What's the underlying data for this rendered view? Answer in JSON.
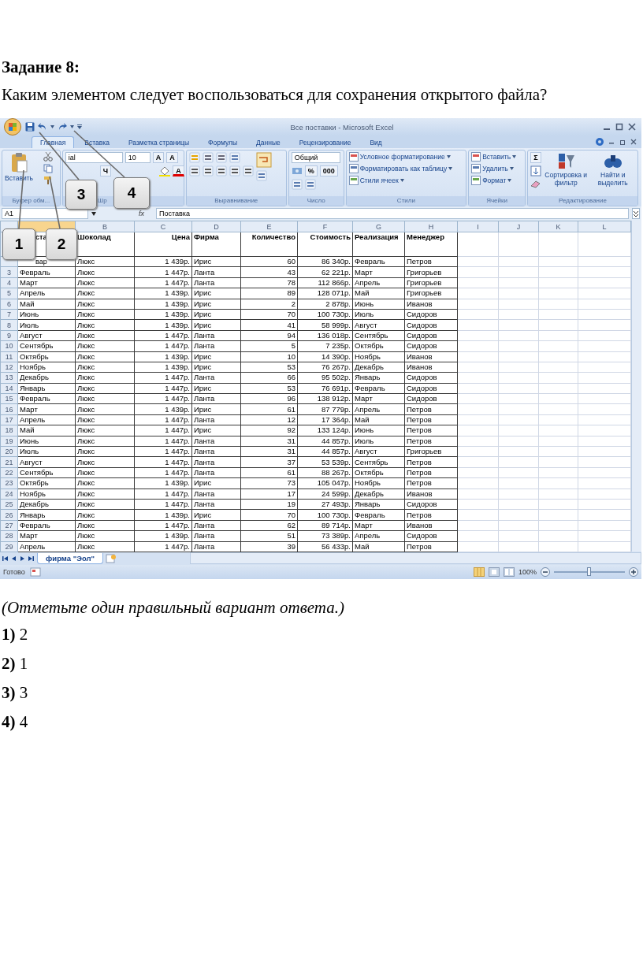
{
  "task": {
    "heading": "Задание 8:",
    "question": "Каким элементом следует воспользоваться для сохранения открытого файла?"
  },
  "excel": {
    "title": "Все поставки - Microsoft Excel",
    "tabs": [
      {
        "label": "Главная",
        "selected": true
      },
      {
        "label": "Вставка",
        "selected": false
      },
      {
        "label": "Разметка страницы",
        "selected": false
      },
      {
        "label": "Формулы",
        "selected": false
      },
      {
        "label": "Данные",
        "selected": false
      },
      {
        "label": "Рецензирование",
        "selected": false
      },
      {
        "label": "Вид",
        "selected": false
      }
    ],
    "ribbon": [
      {
        "kind": "clipboard",
        "label": "Буфер обм...",
        "paste": "Вставить"
      },
      {
        "kind": "font",
        "label": "Шр",
        "font": "ial",
        "size": "10",
        "grow": "A",
        "shrink": "A",
        "underline": "Ч",
        "font_color": "A"
      },
      {
        "kind": "alignment",
        "label": "Выравнивание"
      },
      {
        "kind": "number",
        "label": "Число",
        "format": "Общий",
        "percent": "%",
        "thousands": "000"
      },
      {
        "kind": "styles",
        "label": "Стили",
        "items": [
          "Условное форматирование",
          "Форматировать как таблицу",
          "Стили ячеек"
        ]
      },
      {
        "kind": "cells",
        "label": "Ячейки",
        "items": [
          "Вставить",
          "Удалить",
          "Формат"
        ]
      },
      {
        "kind": "editing",
        "label": "Редактирование",
        "sum": "Σ",
        "items": [
          "Сортировка и фильтр",
          "Найти и выделить"
        ]
      }
    ],
    "name_box": "A1",
    "fx": "fx",
    "formula": "Поставка",
    "columns": [
      {
        "selected": true
      },
      {
        "label": "B",
        "selected": false
      },
      {
        "label": "C",
        "selected": false
      },
      {
        "label": "D",
        "selected": false
      },
      {
        "label": "E",
        "selected": false
      },
      {
        "label": "F",
        "selected": false
      },
      {
        "label": "G",
        "selected": false
      },
      {
        "label": "H",
        "selected": false
      },
      {
        "label": "I",
        "selected": false
      },
      {
        "label": "J",
        "selected": false
      },
      {
        "label": "K",
        "selected": false
      },
      {
        "label": "L",
        "selected": false
      }
    ],
    "header_row": [
      "ста",
      "Шоколад",
      "Цена",
      "Фирма",
      "Количество",
      "Стоимость",
      "Реализация",
      "Менеджер"
    ],
    "rows": [
      {
        "cells": [
          "вар",
          "Люкс",
          "1 439р.",
          "Ирис",
          "60",
          "86 340р.",
          "Февраль",
          "Петров"
        ]
      },
      {
        "number": "3",
        "cells": [
          "Февраль",
          "Люкс",
          "1 447р.",
          "Ланта",
          "43",
          "62 221р.",
          "Март",
          "Григорьев"
        ]
      },
      {
        "number": "4",
        "cells": [
          "Март",
          "Люкс",
          "1 447р.",
          "Ланта",
          "78",
          "112 866р.",
          "Апрель",
          "Григорьев"
        ]
      },
      {
        "number": "5",
        "cells": [
          "Апрель",
          "Люкс",
          "1 439р.",
          "Ирис",
          "89",
          "128 071р.",
          "Май",
          "Григорьев"
        ]
      },
      {
        "number": "6",
        "cells": [
          "Май",
          "Люкс",
          "1 439р.",
          "Ирис",
          "2",
          "2 878р.",
          "Июнь",
          "Иванов"
        ]
      },
      {
        "number": "7",
        "cells": [
          "Июнь",
          "Люкс",
          "1 439р.",
          "Ирис",
          "70",
          "100 730р.",
          "Июль",
          "Сидоров"
        ]
      },
      {
        "number": "8",
        "cells": [
          "Июль",
          "Люкс",
          "1 439р.",
          "Ирис",
          "41",
          "58 999р.",
          "Август",
          "Сидоров"
        ]
      },
      {
        "number": "9",
        "cells": [
          "Август",
          "Люкс",
          "1 447р.",
          "Ланта",
          "94",
          "136 018р.",
          "Сентябрь",
          "Сидоров"
        ]
      },
      {
        "number": "10",
        "cells": [
          "Сентябрь",
          "Люкс",
          "1 447р.",
          "Ланта",
          "5",
          "7 235р.",
          "Октябрь",
          "Сидоров"
        ]
      },
      {
        "number": "11",
        "cells": [
          "Октябрь",
          "Люкс",
          "1 439р.",
          "Ирис",
          "10",
          "14 390р.",
          "Ноябрь",
          "Иванов"
        ]
      },
      {
        "number": "12",
        "cells": [
          "Ноябрь",
          "Люкс",
          "1 439р.",
          "Ирис",
          "53",
          "76 267р.",
          "Декабрь",
          "Иванов"
        ]
      },
      {
        "number": "13",
        "cells": [
          "Декабрь",
          "Люкс",
          "1 447р.",
          "Ланта",
          "66",
          "95 502р.",
          "Январь",
          "Сидоров"
        ]
      },
      {
        "number": "14",
        "cells": [
          "Январь",
          "Люкс",
          "1 447р.",
          "Ирис",
          "53",
          "76 691р.",
          "Февраль",
          "Сидоров"
        ]
      },
      {
        "number": "15",
        "cells": [
          "Февраль",
          "Люкс",
          "1 447р.",
          "Ланта",
          "96",
          "138 912р.",
          "Март",
          "Сидоров"
        ]
      },
      {
        "number": "16",
        "cells": [
          "Март",
          "Люкс",
          "1 439р.",
          "Ирис",
          "61",
          "87 779р.",
          "Апрель",
          "Петров"
        ]
      },
      {
        "number": "17",
        "cells": [
          "Апрель",
          "Люкс",
          "1 447р.",
          "Ланта",
          "12",
          "17 364р.",
          "Май",
          "Петров"
        ]
      },
      {
        "number": "18",
        "cells": [
          "Май",
          "Люкс",
          "1 447р.",
          "Ирис",
          "92",
          "133 124р.",
          "Июнь",
          "Петров"
        ]
      },
      {
        "number": "19",
        "cells": [
          "Июнь",
          "Люкс",
          "1 447р.",
          "Ланта",
          "31",
          "44 857р.",
          "Июль",
          "Петров"
        ]
      },
      {
        "number": "20",
        "cells": [
          "Июль",
          "Люкс",
          "1 447р.",
          "Ланта",
          "31",
          "44 857р.",
          "Август",
          "Григорьев"
        ]
      },
      {
        "number": "21",
        "cells": [
          "Август",
          "Люкс",
          "1 447р.",
          "Ланта",
          "37",
          "53 539р.",
          "Сентябрь",
          "Петров"
        ]
      },
      {
        "number": "22",
        "cells": [
          "Сентябрь",
          "Люкс",
          "1 447р.",
          "Ланта",
          "61",
          "88 267р.",
          "Октябрь",
          "Петров"
        ]
      },
      {
        "number": "23",
        "cells": [
          "Октябрь",
          "Люкс",
          "1 439р.",
          "Ирис",
          "73",
          "105 047р.",
          "Ноябрь",
          "Петров"
        ]
      },
      {
        "number": "24",
        "cells": [
          "Ноябрь",
          "Люкс",
          "1 447р.",
          "Ланта",
          "17",
          "24 599р.",
          "Декабрь",
          "Иванов"
        ]
      },
      {
        "number": "25",
        "cells": [
          "Декабрь",
          "Люкс",
          "1 447р.",
          "Ланта",
          "19",
          "27 493р.",
          "Январь",
          "Сидоров"
        ]
      },
      {
        "number": "26",
        "cells": [
          "Январь",
          "Люкс",
          "1 439р.",
          "Ирис",
          "70",
          "100 730р.",
          "Февраль",
          "Петров"
        ]
      },
      {
        "number": "27",
        "cells": [
          "Февраль",
          "Люкс",
          "1 447р.",
          "Ланта",
          "62",
          "89 714р.",
          "Март",
          "Иванов"
        ]
      },
      {
        "number": "28",
        "cells": [
          "Март",
          "Люкс",
          "1 439р.",
          "Ланта",
          "51",
          "73 389р.",
          "Апрель",
          "Сидоров"
        ]
      },
      {
        "number": "29",
        "cells": [
          "Апрель",
          "Люкс",
          "1 447р.",
          "Ланта",
          "39",
          "56 433р.",
          "Май",
          "Петров"
        ]
      }
    ],
    "sheet_tabs": [
      {
        "label": "фирма \"Эол\"",
        "selected": true
      }
    ],
    "status": "Готово",
    "zoom": "100%",
    "zoom_slider": {
      "level": 0.5
    }
  },
  "callouts": [
    "1",
    "2",
    "3",
    "4"
  ],
  "instruction": "(Отметьте один правильный вариант ответа.)",
  "answers": [
    "**1)** 2",
    "**2)** 1",
    "**3)** 3",
    "**4)** 4"
  ]
}
